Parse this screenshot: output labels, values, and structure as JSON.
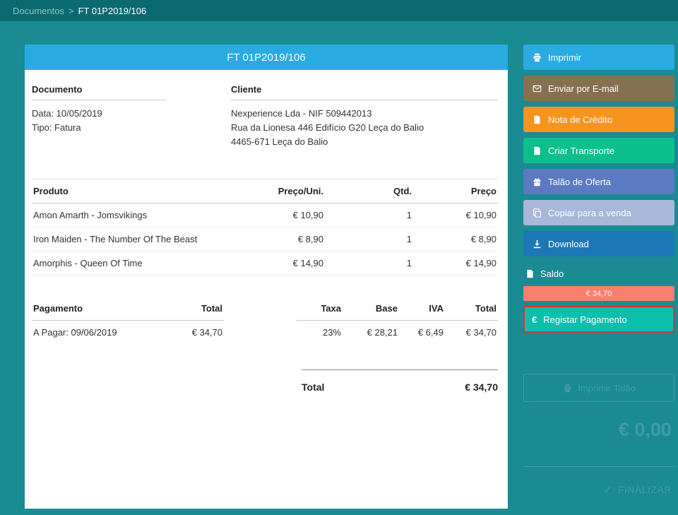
{
  "topbar": {
    "breadcrumb": {
      "root": "Documentos",
      "separator": ">",
      "current": "FT 01P2019/106"
    }
  },
  "invoice": {
    "title": "FT 01P2019/106",
    "document_section": {
      "heading": "Documento",
      "date": "Data: 10/05/2019",
      "type": "Tipo: Fatura"
    },
    "client_section": {
      "heading": "Cliente",
      "name": "Nexperience Lda - NIF 509442013",
      "address1": "Rua da Lionesa 446 Edifício G20 Leça do Balio",
      "address2": "4465-671 Leça do Balio"
    },
    "products": {
      "headers": [
        "Produto",
        "Preço/Uni.",
        "Qtd.",
        "Preço"
      ],
      "rows": [
        [
          "Amon Amarth - Jomsvikings",
          "€ 10,90",
          "1",
          "€ 10,90"
        ],
        [
          "Iron Maiden - The Number Of The Beast",
          "€ 8,90",
          "1",
          "€ 8,90"
        ],
        [
          "Amorphis - Queen Of Time",
          "€ 14,90",
          "1",
          "€ 14,90"
        ]
      ]
    },
    "payment": {
      "headers": [
        "Pagamento",
        "Total"
      ],
      "rows": [
        [
          "A Pagar: 09/06/2019",
          "€ 34,70"
        ]
      ]
    },
    "tax": {
      "headers": [
        "Taxa",
        "Base",
        "IVA",
        "Total"
      ],
      "rows": [
        [
          "23%",
          "€ 28,21",
          "€ 6,49",
          "€ 34,70"
        ]
      ]
    },
    "total": {
      "label": "Total",
      "value": "€ 34,70"
    }
  },
  "sidebar": {
    "actions": [
      {
        "label": "Imprimir",
        "icon": "printer-icon",
        "color": "#29abe2"
      },
      {
        "label": "Enviar por E-mail",
        "icon": "envelope-icon",
        "color": "#857150"
      },
      {
        "label": "Nota de Crédito",
        "icon": "file-icon",
        "color": "#f7941e"
      },
      {
        "label": "Criar Transporte",
        "icon": "file-icon",
        "color": "#0dbf8d"
      },
      {
        "label": "Talão de Oferta",
        "icon": "gift-icon",
        "color": "#5b7ac1"
      },
      {
        "label": "Copiar para a venda",
        "icon": "copy-icon",
        "color": "#a9b7d9"
      },
      {
        "label": "Download",
        "icon": "download-icon",
        "color": "#1c77b7"
      }
    ],
    "saldo": {
      "label": "Saldo",
      "amount": "€ 34,70",
      "badge_color": "#f97f6e"
    },
    "register_payment": {
      "label": "Registar Pagamento",
      "icon_glyph": "€",
      "color": "#0cbfad",
      "highlight_border": "#e03131"
    }
  },
  "background_panel": {
    "print_receipt": "Imprimir Talão",
    "amount": "€ 0,00",
    "finalize_icon": "✓",
    "finalize": "FINALIZAR"
  },
  "colors": {
    "page_bg": "#1a8a93",
    "topbar_bg": "#0b6970",
    "header_bg": "#29abe2"
  }
}
